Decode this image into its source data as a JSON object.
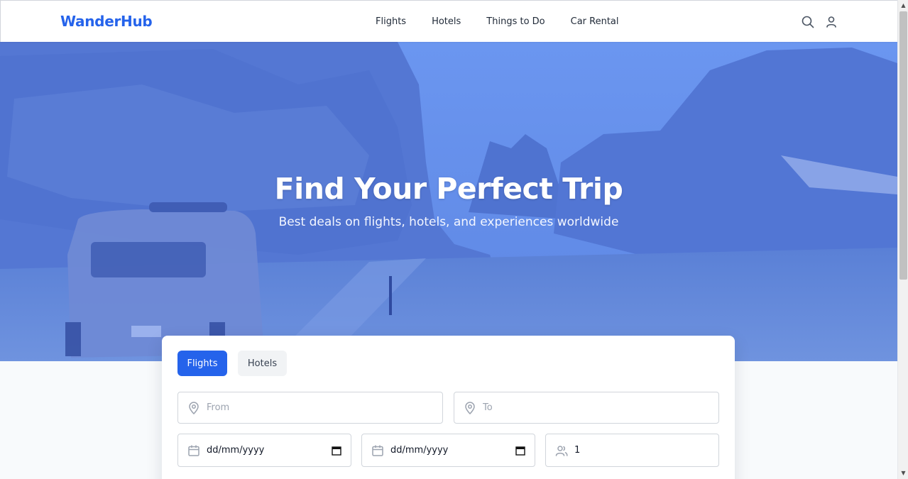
{
  "header": {
    "logo": "WanderHub",
    "nav": [
      "Flights",
      "Hotels",
      "Things to Do",
      "Car Rental"
    ],
    "icons": [
      "search-icon",
      "user-icon"
    ]
  },
  "hero": {
    "title": "Find Your Perfect Trip",
    "subtitle": "Best deals on flights, hotels, and experiences worldwide"
  },
  "search": {
    "tabs": [
      {
        "label": "Flights",
        "active": true
      },
      {
        "label": "Hotels",
        "active": false
      }
    ],
    "from_placeholder": "From",
    "to_placeholder": "To",
    "depart_date": "dd/mm/yyyy",
    "return_date": "dd/mm/yyyy",
    "travelers": "1"
  },
  "colors": {
    "brand": "#2563eb",
    "hero_overlay": "#3b6fe0",
    "text": "#1f2937"
  }
}
